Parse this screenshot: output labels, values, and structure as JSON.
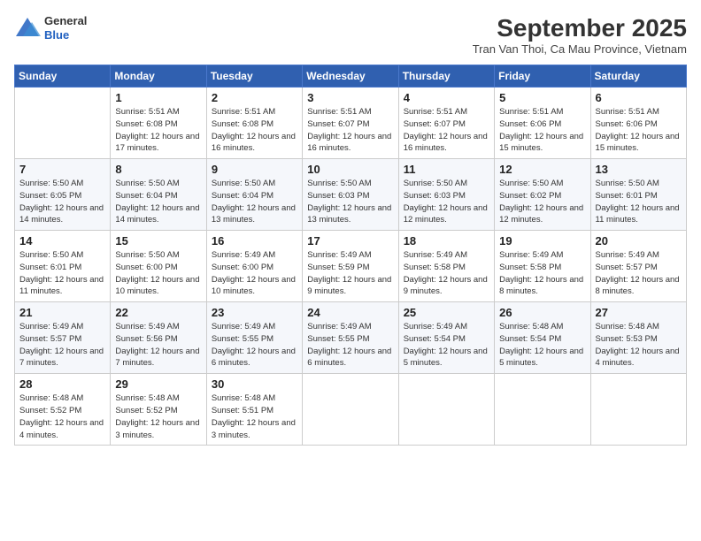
{
  "header": {
    "logo": {
      "line1": "General",
      "line2": "Blue"
    },
    "title": "September 2025",
    "location": "Tran Van Thoi, Ca Mau Province, Vietnam"
  },
  "weekdays": [
    "Sunday",
    "Monday",
    "Tuesday",
    "Wednesday",
    "Thursday",
    "Friday",
    "Saturday"
  ],
  "weeks": [
    [
      null,
      {
        "day": "1",
        "sunrise": "5:51 AM",
        "sunset": "6:08 PM",
        "daylight": "12 hours and 17 minutes."
      },
      {
        "day": "2",
        "sunrise": "5:51 AM",
        "sunset": "6:08 PM",
        "daylight": "12 hours and 16 minutes."
      },
      {
        "day": "3",
        "sunrise": "5:51 AM",
        "sunset": "6:07 PM",
        "daylight": "12 hours and 16 minutes."
      },
      {
        "day": "4",
        "sunrise": "5:51 AM",
        "sunset": "6:07 PM",
        "daylight": "12 hours and 16 minutes."
      },
      {
        "day": "5",
        "sunrise": "5:51 AM",
        "sunset": "6:06 PM",
        "daylight": "12 hours and 15 minutes."
      },
      {
        "day": "6",
        "sunrise": "5:51 AM",
        "sunset": "6:06 PM",
        "daylight": "12 hours and 15 minutes."
      }
    ],
    [
      {
        "day": "7",
        "sunrise": "5:50 AM",
        "sunset": "6:05 PM",
        "daylight": "12 hours and 14 minutes."
      },
      {
        "day": "8",
        "sunrise": "5:50 AM",
        "sunset": "6:04 PM",
        "daylight": "12 hours and 14 minutes."
      },
      {
        "day": "9",
        "sunrise": "5:50 AM",
        "sunset": "6:04 PM",
        "daylight": "12 hours and 13 minutes."
      },
      {
        "day": "10",
        "sunrise": "5:50 AM",
        "sunset": "6:03 PM",
        "daylight": "12 hours and 13 minutes."
      },
      {
        "day": "11",
        "sunrise": "5:50 AM",
        "sunset": "6:03 PM",
        "daylight": "12 hours and 12 minutes."
      },
      {
        "day": "12",
        "sunrise": "5:50 AM",
        "sunset": "6:02 PM",
        "daylight": "12 hours and 12 minutes."
      },
      {
        "day": "13",
        "sunrise": "5:50 AM",
        "sunset": "6:01 PM",
        "daylight": "12 hours and 11 minutes."
      }
    ],
    [
      {
        "day": "14",
        "sunrise": "5:50 AM",
        "sunset": "6:01 PM",
        "daylight": "12 hours and 11 minutes."
      },
      {
        "day": "15",
        "sunrise": "5:50 AM",
        "sunset": "6:00 PM",
        "daylight": "12 hours and 10 minutes."
      },
      {
        "day": "16",
        "sunrise": "5:49 AM",
        "sunset": "6:00 PM",
        "daylight": "12 hours and 10 minutes."
      },
      {
        "day": "17",
        "sunrise": "5:49 AM",
        "sunset": "5:59 PM",
        "daylight": "12 hours and 9 minutes."
      },
      {
        "day": "18",
        "sunrise": "5:49 AM",
        "sunset": "5:58 PM",
        "daylight": "12 hours and 9 minutes."
      },
      {
        "day": "19",
        "sunrise": "5:49 AM",
        "sunset": "5:58 PM",
        "daylight": "12 hours and 8 minutes."
      },
      {
        "day": "20",
        "sunrise": "5:49 AM",
        "sunset": "5:57 PM",
        "daylight": "12 hours and 8 minutes."
      }
    ],
    [
      {
        "day": "21",
        "sunrise": "5:49 AM",
        "sunset": "5:57 PM",
        "daylight": "12 hours and 7 minutes."
      },
      {
        "day": "22",
        "sunrise": "5:49 AM",
        "sunset": "5:56 PM",
        "daylight": "12 hours and 7 minutes."
      },
      {
        "day": "23",
        "sunrise": "5:49 AM",
        "sunset": "5:55 PM",
        "daylight": "12 hours and 6 minutes."
      },
      {
        "day": "24",
        "sunrise": "5:49 AM",
        "sunset": "5:55 PM",
        "daylight": "12 hours and 6 minutes."
      },
      {
        "day": "25",
        "sunrise": "5:49 AM",
        "sunset": "5:54 PM",
        "daylight": "12 hours and 5 minutes."
      },
      {
        "day": "26",
        "sunrise": "5:48 AM",
        "sunset": "5:54 PM",
        "daylight": "12 hours and 5 minutes."
      },
      {
        "day": "27",
        "sunrise": "5:48 AM",
        "sunset": "5:53 PM",
        "daylight": "12 hours and 4 minutes."
      }
    ],
    [
      {
        "day": "28",
        "sunrise": "5:48 AM",
        "sunset": "5:52 PM",
        "daylight": "12 hours and 4 minutes."
      },
      {
        "day": "29",
        "sunrise": "5:48 AM",
        "sunset": "5:52 PM",
        "daylight": "12 hours and 3 minutes."
      },
      {
        "day": "30",
        "sunrise": "5:48 AM",
        "sunset": "5:51 PM",
        "daylight": "12 hours and 3 minutes."
      },
      null,
      null,
      null,
      null
    ]
  ]
}
